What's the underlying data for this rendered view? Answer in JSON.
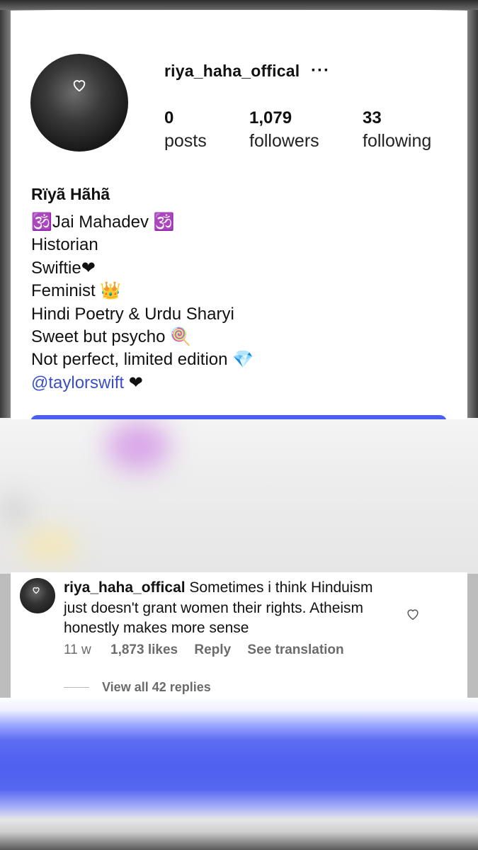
{
  "profile": {
    "username": "riya_haha_offical",
    "more_label": "···",
    "stats": [
      {
        "value": "0",
        "label": "posts"
      },
      {
        "value": "1,079",
        "label": "followers"
      },
      {
        "value": "33",
        "label": "following"
      }
    ],
    "display_name": "Rïyã Hãhã",
    "bio": [
      "🕉️Jai Mahadev 🕉️",
      "Historian",
      "Swiftie❤",
      "Feminist 👑",
      "Hindi Poetry & Urdu Sharyi",
      "Sweet but psycho 🍭",
      "Not perfect, limited edition 💎"
    ],
    "mention": "@taylorswift",
    "mention_suffix": " ❤",
    "colors": {
      "link": "#3a4fc6",
      "button": "#4a5ff0"
    }
  },
  "comment": {
    "username": "riya_haha_offical",
    "text": " Sometimes i think Hinduism just doesn't grant women their rights. Atheism honestly makes more sense",
    "time": "11 w",
    "likes": "1,873 likes",
    "reply_label": "Reply",
    "translation_label": "See translation",
    "view_replies": "View all 42 replies",
    "like_icon": "heart-outline-icon"
  }
}
